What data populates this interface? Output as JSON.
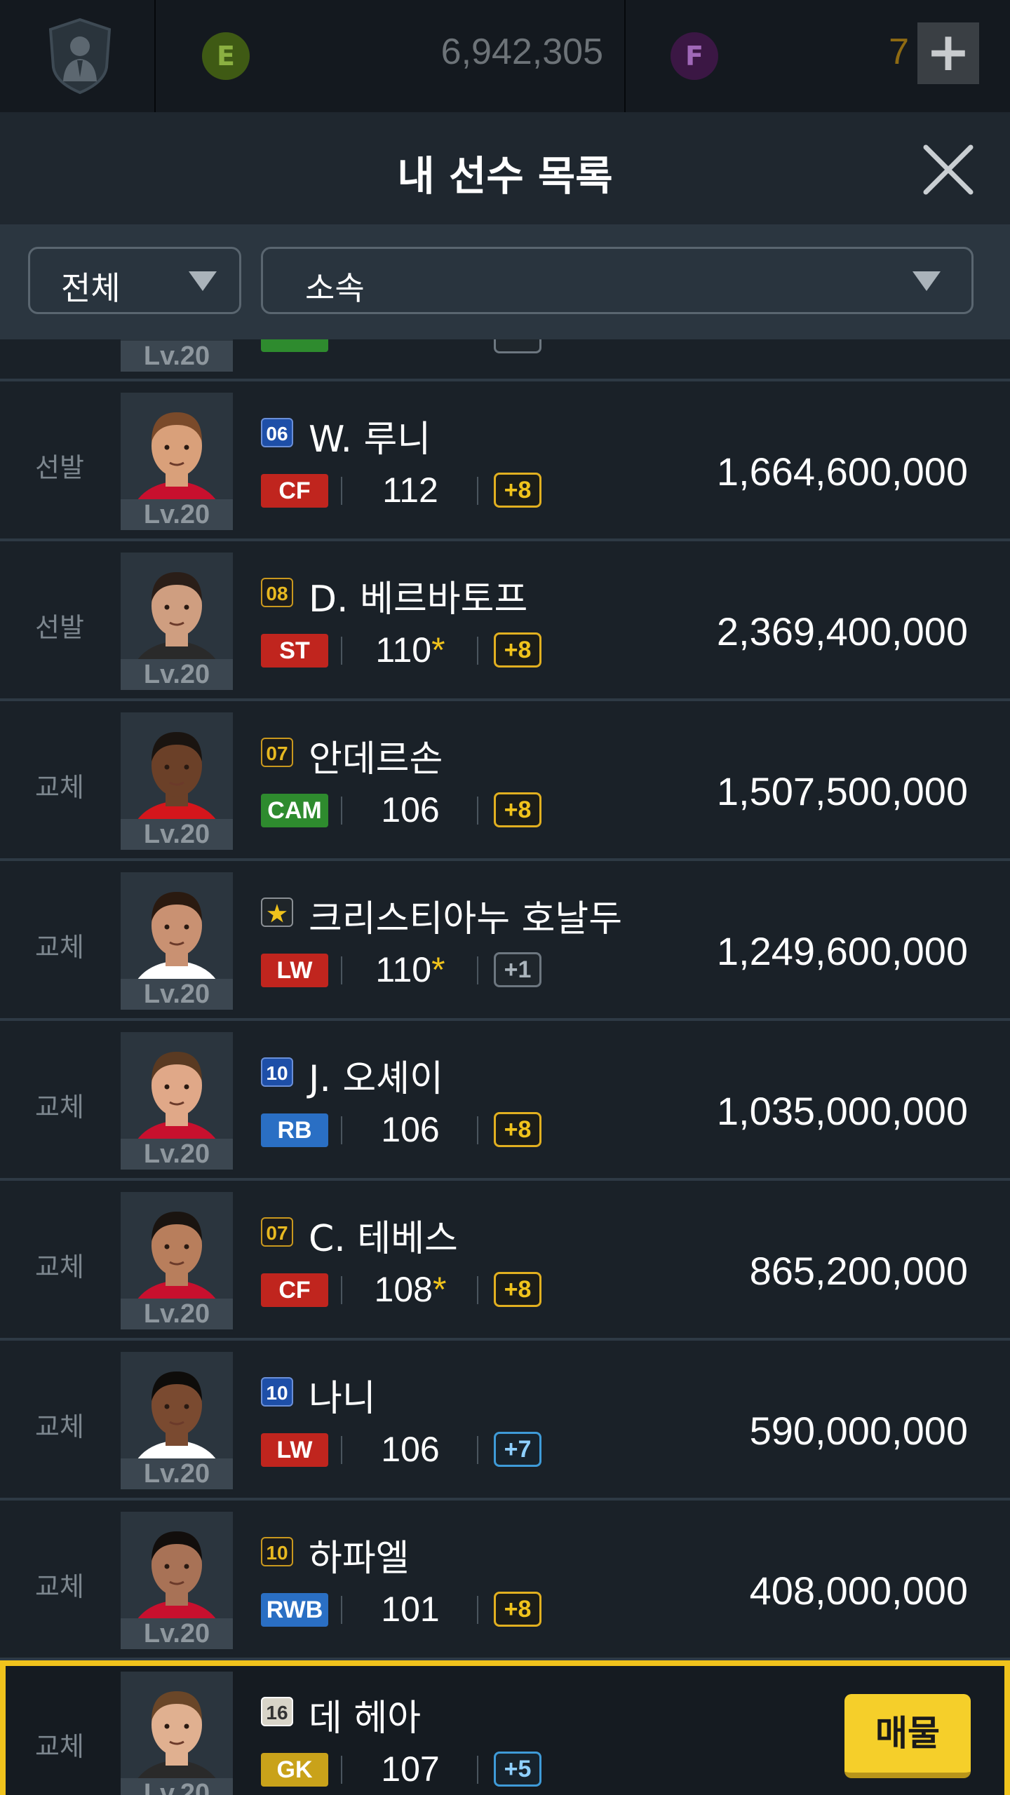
{
  "topbar": {
    "e_label": "E",
    "cash": "6,942,305",
    "f_label": "F",
    "f_count": "7",
    "plus": "+"
  },
  "header": {
    "title": "내 선수 목록"
  },
  "filters": {
    "category": "전체",
    "club": "소속"
  },
  "peek_row": {
    "level": "Lv.20"
  },
  "players": [
    {
      "status": "선발",
      "season": "06",
      "season_style": "blue",
      "name": "W. 루니",
      "position": "CF",
      "pos_color": "#c0251e",
      "ovr": "112",
      "star": "",
      "upgrade": "+8",
      "upgrade_style": "gold",
      "price": "1,664,600,000",
      "level": "Lv.20",
      "kit": "#c8102e",
      "hair": "#7a4a2a",
      "skin": "#d9a07a"
    },
    {
      "status": "선발",
      "season": "08",
      "season_style": "gold",
      "name": "D. 베르바토프",
      "position": "ST",
      "pos_color": "#c0251e",
      "ovr": "110",
      "star": "*",
      "upgrade": "+8",
      "upgrade_style": "gold",
      "price": "2,369,400,000",
      "level": "Lv.20",
      "kit": "#2a2a2a",
      "hair": "#2a1e18",
      "skin": "#cf9e80"
    },
    {
      "status": "교체",
      "season": "07",
      "season_style": "gold",
      "name": "안데르손",
      "position": "CAM",
      "pos_color": "#2e8b2e",
      "ovr": "106",
      "star": "",
      "upgrade": "+8",
      "upgrade_style": "gold",
      "price": "1,507,500,000",
      "level": "Lv.20",
      "kit": "#d4161c",
      "hair": "#1a1410",
      "skin": "#6b4028"
    },
    {
      "status": "교체",
      "season": "★",
      "season_style": "star",
      "name": "크리스티아누 호날두",
      "position": "LW",
      "pos_color": "#c0251e",
      "ovr": "110",
      "star": "*",
      "upgrade": "+1",
      "upgrade_style": "grey",
      "price": "1,249,600,000",
      "level": "Lv.20",
      "kit": "#ffffff",
      "hair": "#2a1a10",
      "skin": "#c99172"
    },
    {
      "status": "교체",
      "season": "10",
      "season_style": "blue",
      "name": "J. 오셰이",
      "position": "RB",
      "pos_color": "#2a6fc4",
      "ovr": "106",
      "star": "",
      "upgrade": "+8",
      "upgrade_style": "gold",
      "price": "1,035,000,000",
      "level": "Lv.20",
      "kit": "#c8102e",
      "hair": "#5a3a22",
      "skin": "#e0a888"
    },
    {
      "status": "교체",
      "season": "07",
      "season_style": "gold",
      "name": "C. 테베스",
      "position": "CF",
      "pos_color": "#c0251e",
      "ovr": "108",
      "star": "*",
      "upgrade": "+8",
      "upgrade_style": "gold",
      "price": "865,200,000",
      "level": "Lv.20",
      "kit": "#c8102e",
      "hair": "#1a1410",
      "skin": "#b87e5c"
    },
    {
      "status": "교체",
      "season": "10",
      "season_style": "blue",
      "name": "나니",
      "position": "LW",
      "pos_color": "#c0251e",
      "ovr": "106",
      "star": "",
      "upgrade": "+7",
      "upgrade_style": "blue",
      "price": "590,000,000",
      "level": "Lv.20",
      "kit": "#ffffff",
      "hair": "#0e0c0a",
      "skin": "#7a4a30"
    },
    {
      "status": "교체",
      "season": "10",
      "season_style": "gold",
      "name": "하파엘",
      "position": "RWB",
      "pos_color": "#2a6fc4",
      "ovr": "101",
      "star": "",
      "upgrade": "+8",
      "upgrade_style": "gold",
      "price": "408,000,000",
      "level": "Lv.20",
      "kit": "#c8102e",
      "hair": "#120e0c",
      "skin": "#a87256"
    },
    {
      "status": "교체",
      "season": "16",
      "season_style": "icon",
      "name": "데 헤아",
      "position": "GK",
      "pos_color": "#c9a21a",
      "ovr": "107",
      "star": "",
      "upgrade": "+5",
      "upgrade_style": "blue",
      "price": "",
      "level": "Lv.20",
      "kit": "#2a2a2a",
      "hair": "#6a4628",
      "skin": "#e0b090",
      "selected": true,
      "action": "매물"
    }
  ]
}
